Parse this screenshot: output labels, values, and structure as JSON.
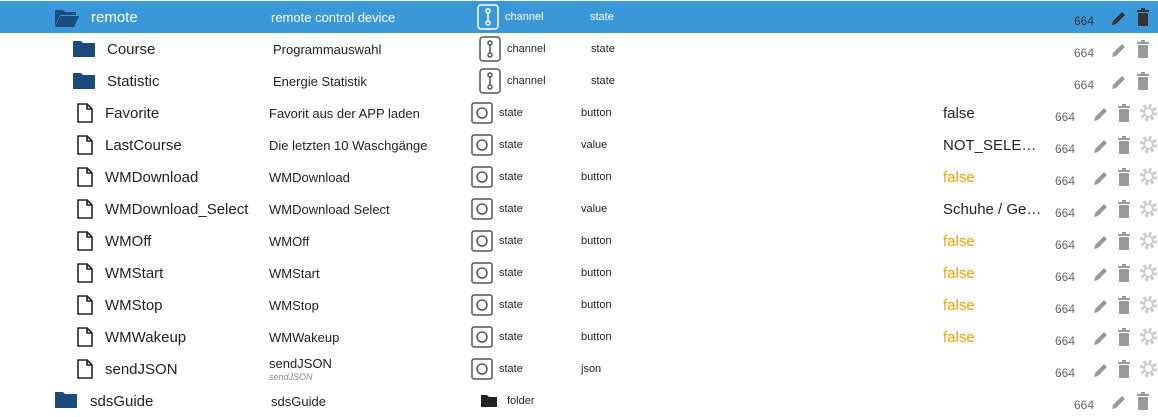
{
  "rows": [
    {
      "name": "remote",
      "desc": "remote control device",
      "type": "channel",
      "role": "state",
      "acl": "664",
      "selected": true,
      "icon": "folder-open-icon",
      "level": 0
    },
    {
      "name": "Course",
      "desc": "Programmauswahl",
      "type": "channel",
      "role": "state",
      "acl": "664",
      "icon": "folder-icon",
      "level": 1
    },
    {
      "name": "Statistic",
      "desc": "Energie Statistik",
      "type": "channel",
      "role": "state",
      "acl": "664",
      "icon": "folder-icon",
      "level": 1
    },
    {
      "name": "Favorite",
      "desc": "Favorit aus der APP laden",
      "type": "state",
      "role": "button",
      "value": "false",
      "value_color": "default",
      "acl": "664",
      "icon": "file-icon",
      "level": 1
    },
    {
      "name": "LastCourse",
      "desc": "Die letzten 10 Waschgänge",
      "type": "state",
      "role": "value",
      "value": "NOT_SELECTED",
      "value_color": "default",
      "acl": "664",
      "icon": "file-icon",
      "level": 1
    },
    {
      "name": "WMDownload",
      "desc": "WMDownload",
      "type": "state",
      "role": "button",
      "value": "false",
      "value_color": "orange",
      "acl": "664",
      "icon": "file-icon",
      "level": 1
    },
    {
      "name": "WMDownload_Select",
      "desc": "WMDownload Select",
      "type": "state",
      "role": "value",
      "value": "Schuhe / Gemischt",
      "value_color": "default",
      "acl": "664",
      "icon": "file-icon",
      "level": 1
    },
    {
      "name": "WMOff",
      "desc": "WMOff",
      "type": "state",
      "role": "button",
      "value": "false",
      "value_color": "orange",
      "acl": "664",
      "icon": "file-icon",
      "level": 1
    },
    {
      "name": "WMStart",
      "desc": "WMStart",
      "type": "state",
      "role": "button",
      "value": "false",
      "value_color": "orange",
      "acl": "664",
      "icon": "file-icon",
      "level": 1
    },
    {
      "name": "WMStop",
      "desc": "WMStop",
      "type": "state",
      "role": "button",
      "value": "false",
      "value_color": "orange",
      "acl": "664",
      "icon": "file-icon",
      "level": 1
    },
    {
      "name": "WMWakeup",
      "desc": "WMWakeup",
      "type": "state",
      "role": "button",
      "value": "false",
      "value_color": "orange",
      "acl": "664",
      "icon": "file-icon",
      "level": 1
    },
    {
      "name": "sendJSON",
      "desc": "sendJSON",
      "desc_sub": "sendJSON",
      "type": "state",
      "role": "json",
      "value": "",
      "value_color": "default",
      "acl": "664",
      "icon": "file-icon",
      "level": 1
    },
    {
      "name": "sdsGuide",
      "desc": "sdsGuide",
      "type": "folder",
      "role": "",
      "acl": "664",
      "icon": "folder-icon",
      "level": 0
    }
  ],
  "colors": {
    "selected_bg": "#3a98d8",
    "folder": "#1b4a7c",
    "value_orange": "#f0a000",
    "action_icon": "#999999"
  }
}
